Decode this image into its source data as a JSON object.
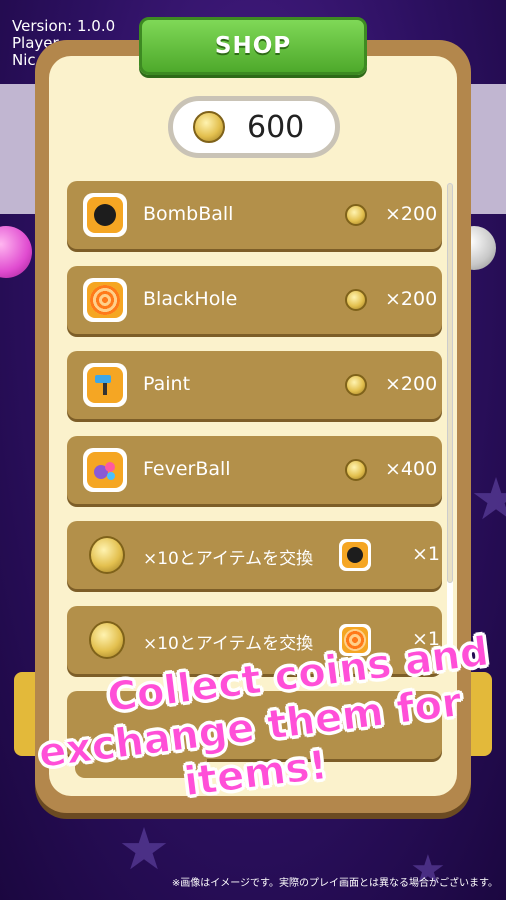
{
  "background": {
    "version_text": "Version: 1.0.0",
    "player_text": "Player",
    "nick_text": "Nic"
  },
  "shop": {
    "title": "SHOP",
    "coins": "600"
  },
  "items": [
    {
      "name": "BombBall",
      "price": "×200",
      "icon": "bomb-icon"
    },
    {
      "name": "BlackHole",
      "price": "×200",
      "icon": "spiral-icon"
    },
    {
      "name": "Paint",
      "price": "×200",
      "icon": "paint-roller-icon"
    },
    {
      "name": "FeverBall",
      "price": "×400",
      "icon": "fever-ball-icon"
    }
  ],
  "exchanges": [
    {
      "label": "×10とアイテムを交換",
      "qty": "×1",
      "icon": "bomb-icon"
    },
    {
      "label": "×10とアイテムを交換",
      "qty": "×1",
      "icon": "spiral-icon"
    }
  ],
  "promo": {
    "line1": "Collect coins and",
    "line2": "exchange them for items!"
  },
  "disclaimer": "※画像はイメージです。実際のプレイ画面とは異なる場合がございます。",
  "colors": {
    "promo": "#ff4fd8",
    "tab_green": "#4ea92b",
    "row_gold": "#b3904a"
  }
}
